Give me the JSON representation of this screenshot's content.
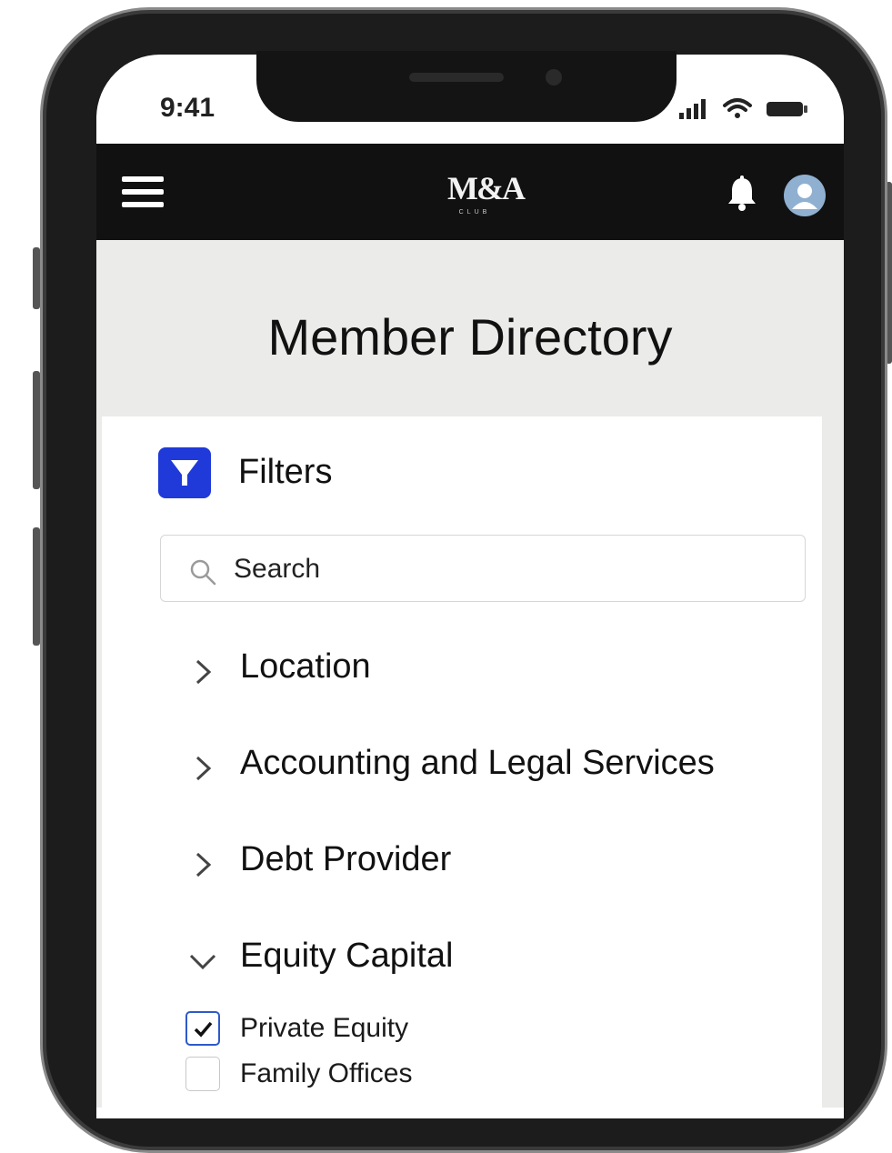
{
  "status_bar": {
    "time": "9:41",
    "icons": [
      "signal-icon",
      "wifi-icon",
      "battery-icon"
    ]
  },
  "header": {
    "logo_text": "M&A",
    "logo_subtext": "CLUB",
    "icons": [
      "hamburger-menu-icon",
      "bell-icon",
      "user-avatar-icon"
    ]
  },
  "page": {
    "title": "Member Directory"
  },
  "filters": {
    "heading": "Filters",
    "search_placeholder": "Search",
    "categories": [
      {
        "label": "Location",
        "expanded": false
      },
      {
        "label": "Accounting and Legal Services",
        "expanded": false
      },
      {
        "label": "Debt Provider",
        "expanded": false
      },
      {
        "label": "Equity Capital",
        "expanded": true
      }
    ],
    "equity_options": [
      {
        "label": "Private Equity",
        "checked": true
      },
      {
        "label": "Family Offices",
        "checked": false
      }
    ]
  },
  "colors": {
    "header_bg": "#111111",
    "title_band_bg": "#ebebe9",
    "filter_icon_bg": "#1f3ad8",
    "checkbox_accent": "#2e59c9"
  }
}
